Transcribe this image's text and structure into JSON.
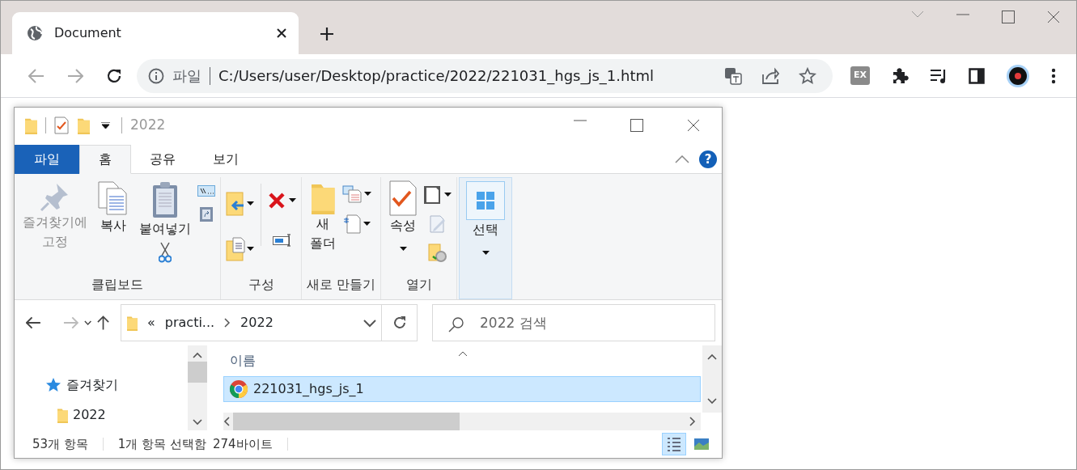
{
  "browser": {
    "tab": {
      "title": "Document"
    },
    "address": {
      "scheme": "파일",
      "url": "C:/Users/user/Desktop/practice/2022/221031_hgs_js_1.html"
    },
    "extension_badge": "EX"
  },
  "explorer": {
    "title": "2022",
    "ribbon_tabs": [
      {
        "label": "파일",
        "kind": "file",
        "selected": false
      },
      {
        "label": "홈",
        "kind": "tab",
        "selected": true
      },
      {
        "label": "공유",
        "kind": "tab",
        "selected": false
      },
      {
        "label": "보기",
        "kind": "tab",
        "selected": false
      }
    ],
    "help": "?",
    "groups": [
      {
        "kind": "clipboard",
        "label": "클립보드",
        "commands": [
          {
            "kind": "pin",
            "label": "즐겨찾기에\n고정",
            "disabled": true,
            "dropdown": false,
            "highlighted": false
          },
          {
            "kind": "copy",
            "label": "복사",
            "disabled": false,
            "dropdown": false,
            "highlighted": false
          },
          {
            "kind": "paste",
            "label": "붙여넣기",
            "disabled": false,
            "dropdown": false,
            "highlighted": false
          }
        ]
      },
      {
        "kind": "organize",
        "label": "구성"
      },
      {
        "kind": "new",
        "label": "새로 만들기",
        "commands": [
          {
            "kind": "new-folder",
            "label": "새\n폴더",
            "disabled": false,
            "dropdown": false,
            "highlighted": false
          }
        ]
      },
      {
        "kind": "open",
        "label": "열기",
        "commands": [
          {
            "kind": "properties",
            "label": "속성",
            "disabled": false,
            "dropdown": true,
            "highlighted": false
          }
        ]
      },
      {
        "kind": "select",
        "commands": [
          {
            "kind": "select",
            "label": "선택",
            "disabled": false,
            "dropdown": true,
            "highlighted": true
          }
        ]
      }
    ],
    "breadcrumb": {
      "overflow": "«",
      "parts": [
        "practi...",
        "2022"
      ]
    },
    "search": {
      "placeholder": "2022 검색"
    },
    "sidebar": {
      "items": [
        {
          "label": "즐겨찾기",
          "kind": "quick-access",
          "children": [
            {
              "label": "2022",
              "kind": "folder"
            }
          ]
        }
      ]
    },
    "columns": [
      "이름"
    ],
    "files": [
      {
        "name": "221031_hgs_js_1",
        "selected": true
      }
    ],
    "status_bar": {
      "count": "53개 항목",
      "selection": "1개 항목 선택함",
      "size": "274바이트"
    },
    "views": [
      {
        "kind": "details",
        "selected": true
      },
      {
        "kind": "large-icons",
        "selected": false
      }
    ]
  }
}
